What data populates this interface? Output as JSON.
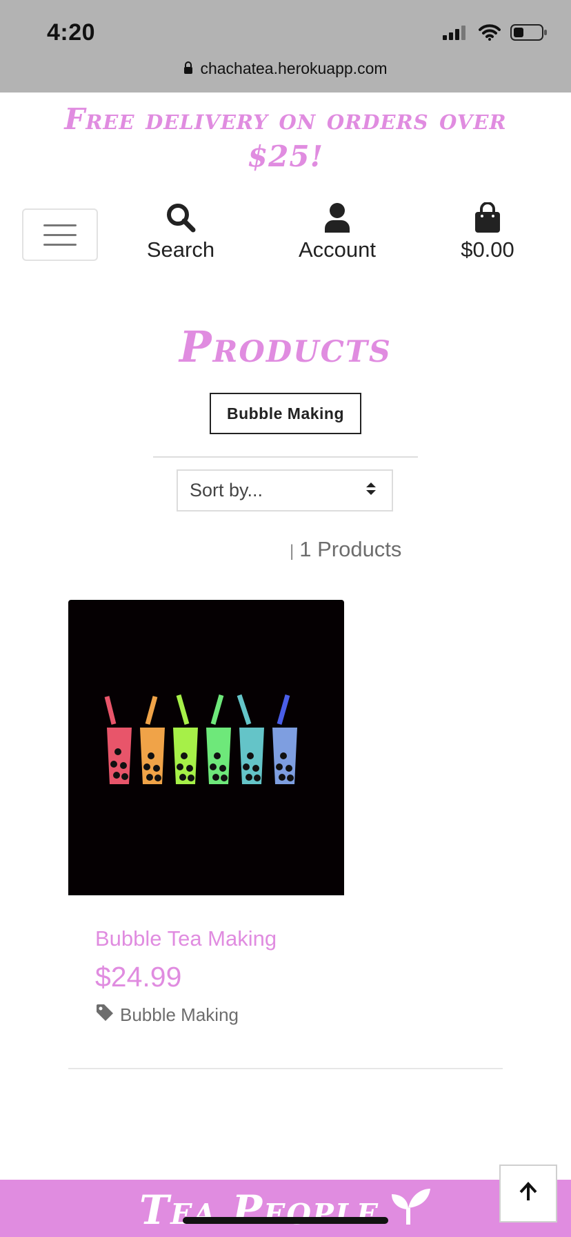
{
  "status_bar": {
    "time": "4:20",
    "icons": [
      "cellular-signal-icon",
      "wifi-icon",
      "battery-icon"
    ]
  },
  "browser": {
    "url": "chachatea.herokuapp.com",
    "lock_icon": "lock-icon"
  },
  "promo_banner": {
    "text": "Free delivery on orders over $25!"
  },
  "header": {
    "menu_icon": "hamburger-menu-icon",
    "search": {
      "label": "Search",
      "icon": "search-icon"
    },
    "account": {
      "label": "Account",
      "icon": "user-icon"
    },
    "cart": {
      "label": "$0.00",
      "icon": "shopping-bag-icon"
    }
  },
  "main": {
    "title": "Products",
    "category_button": "Bubble Making",
    "sort": {
      "selected": "Sort by..."
    },
    "count": {
      "separator": "|",
      "text": "1 Products"
    }
  },
  "products": [
    {
      "name": "Bubble Tea Making",
      "price": "$24.99",
      "tag": "Bubble Making",
      "tag_icon": "tag-icon"
    }
  ],
  "footer": {
    "brand": "Tea People",
    "brand_icon": "sprout-icon",
    "back_to_top_icon": "arrow-up-icon"
  },
  "colors": {
    "brand_pink": "#e08ce0",
    "status_bar_bg": "#b3b3b3",
    "text_dark": "#222222",
    "text_muted": "#6d6d6d",
    "cup_colors": [
      "#e8556a",
      "#f0a348",
      "#a6f048",
      "#6ee87a",
      "#64c4c8",
      "#7e9ee0"
    ]
  }
}
